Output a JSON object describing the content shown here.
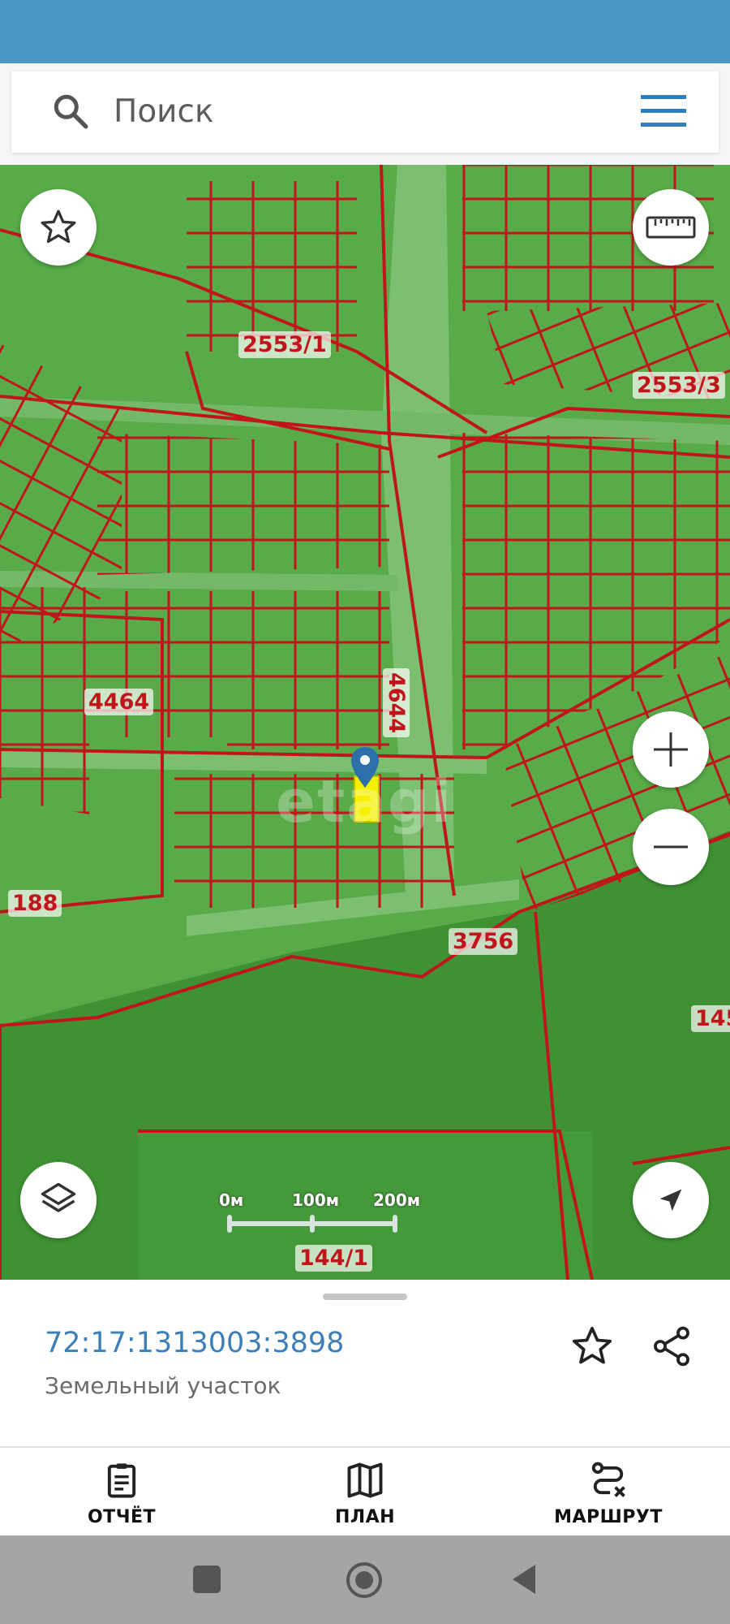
{
  "search": {
    "placeholder": "Поиск"
  },
  "map": {
    "parcel_labels": [
      {
        "id": "2553-1",
        "text": "2553/1"
      },
      {
        "id": "2553-3",
        "text": "2553/3"
      },
      {
        "id": "4644",
        "text": "4644"
      },
      {
        "id": "4464",
        "text": "4464"
      },
      {
        "id": "188",
        "text": "188"
      },
      {
        "id": "3756",
        "text": "3756"
      },
      {
        "id": "145",
        "text": "145"
      },
      {
        "id": "144-1",
        "text": "144/1"
      }
    ],
    "watermark": "etagi",
    "scale": {
      "labels": [
        "0м",
        "100м",
        "200м"
      ]
    }
  },
  "parcel": {
    "cadastral_number": "72:17:1313003:3898",
    "type": "Земельный участок"
  },
  "bottom_nav": [
    {
      "label": "ОТЧЁТ",
      "icon": "report-icon"
    },
    {
      "label": "ПЛАН",
      "icon": "map-plan-icon"
    },
    {
      "label": "МАРШРУТ",
      "icon": "route-icon"
    }
  ],
  "colors": {
    "header": "#4b97c4",
    "map_green": "#4a9e3c",
    "boundary_red": "#c0161b",
    "link_blue": "#3f7fb7",
    "selected_parcel": "#f5f000"
  }
}
